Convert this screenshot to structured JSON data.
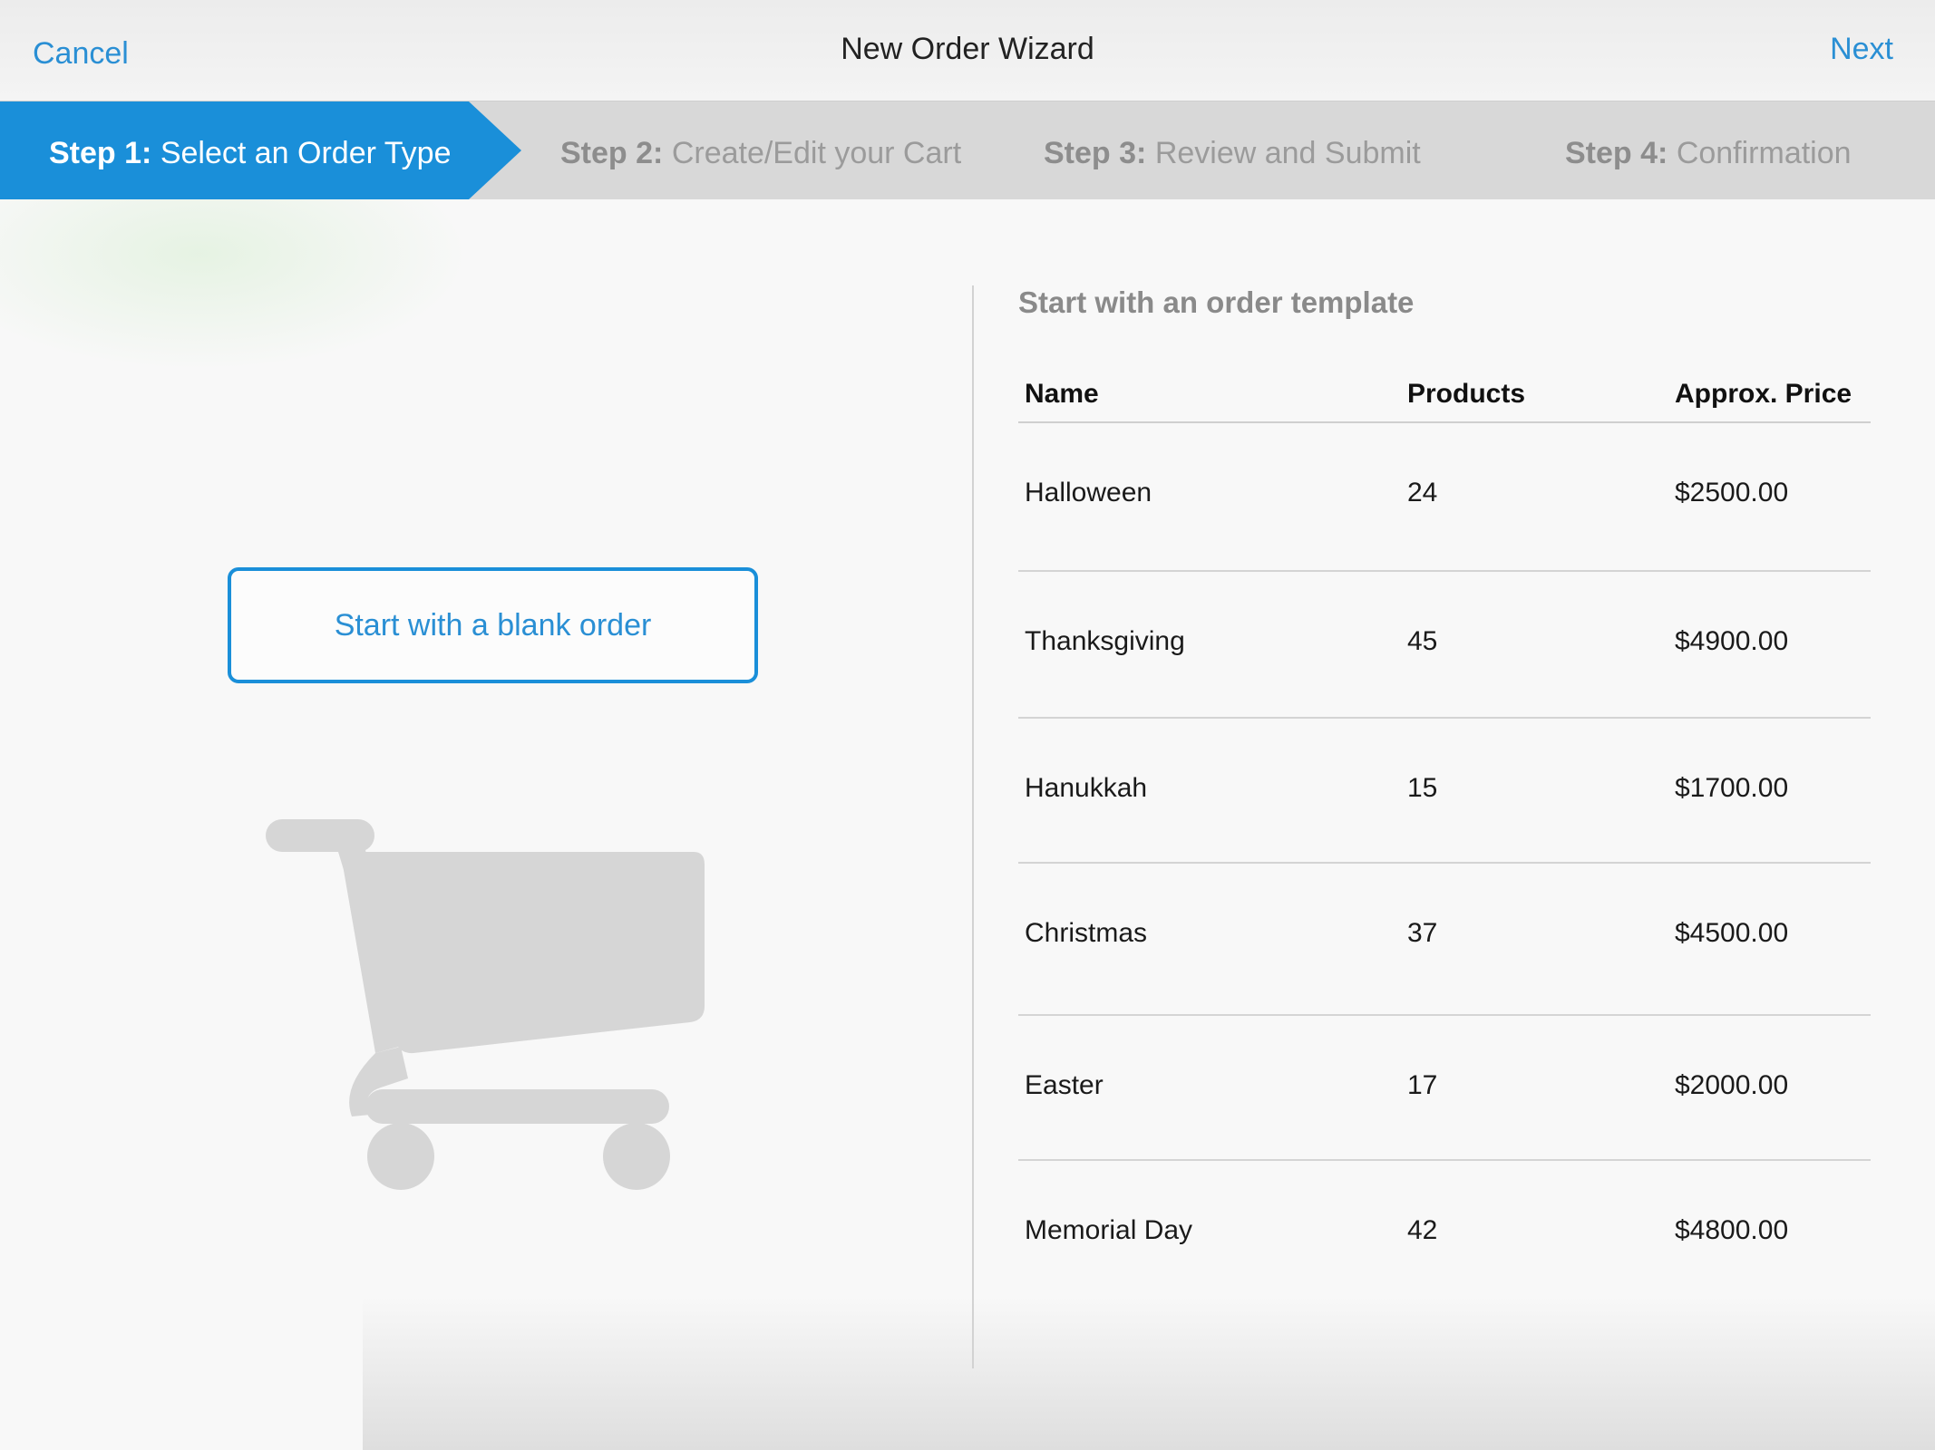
{
  "nav": {
    "cancel_label": "Cancel",
    "title": "New Order Wizard",
    "next_label": "Next"
  },
  "steps": [
    {
      "number": "Step 1:",
      "label": "Select an Order Type",
      "active": true
    },
    {
      "number": "Step 2:",
      "label": "Create/Edit your Cart",
      "active": false
    },
    {
      "number": "Step 3:",
      "label": "Review and Submit",
      "active": false
    },
    {
      "number": "Step 4:",
      "label": "Confirmation",
      "active": false
    }
  ],
  "left_pane": {
    "blank_order_label": "Start with a blank order",
    "cart_icon": "shopping-cart-icon"
  },
  "templates": {
    "heading": "Start with an order template",
    "columns": [
      "Name",
      "Products",
      "Approx. Price"
    ],
    "rows": [
      {
        "name": "Halloween",
        "products": "24",
        "price": "$2500.00"
      },
      {
        "name": "Thanksgiving",
        "products": "45",
        "price": "$4900.00"
      },
      {
        "name": "Hanukkah",
        "products": "15",
        "price": "$1700.00"
      },
      {
        "name": "Christmas",
        "products": "37",
        "price": "$4500.00"
      },
      {
        "name": "Easter",
        "products": "17",
        "price": "$2000.00"
      },
      {
        "name": "Memorial Day",
        "products": "42",
        "price": "$4800.00"
      }
    ]
  },
  "colors": {
    "accent": "#1a8fd9",
    "link": "#2a8fd4",
    "step_bar": "#d8d8d8",
    "cart_icon": "#d6d6d6"
  }
}
